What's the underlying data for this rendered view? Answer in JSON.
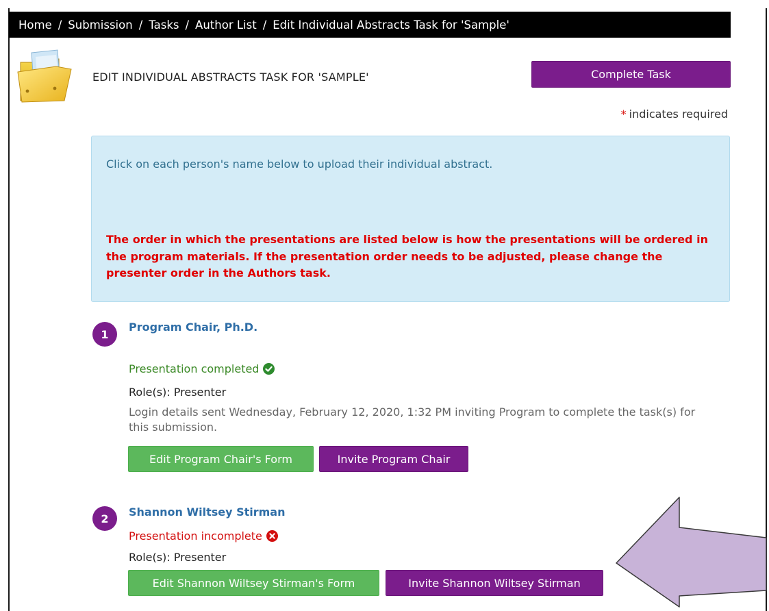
{
  "breadcrumb": [
    "Home",
    "Submission",
    "Tasks",
    "Author List",
    "Edit Individual Abstracts Task for 'Sample'"
  ],
  "breadcrumb_separator": "/",
  "page": {
    "title": "EDIT INDIVIDUAL ABSTRACTS TASK FOR 'SAMPLE'",
    "complete_button": "Complete Task",
    "required_star": "*",
    "required_text": "indicates required"
  },
  "info": {
    "instruction": "Click on each person's name below to upload their individual abstract.",
    "warning": "The order in which the presentations are listed below is how the presentations will be ordered in the program materials. If the presentation order needs to be adjusted, please change the presenter order in the Authors task."
  },
  "presenters": [
    {
      "number": "1",
      "name": "Program Chair, Ph.D.",
      "status": "Presentation completed",
      "role": "Role(s): Presenter",
      "login": "Login details sent Wednesday, February 12, 2020, 1:32 PM inviting Program to complete the task(s) for this submission.",
      "edit_button": "Edit Program Chair's Form",
      "invite_button": "Invite Program Chair"
    },
    {
      "number": "2",
      "name": "Shannon Wiltsey Stirman",
      "status": "Presentation incomplete",
      "role": "Role(s): Presenter",
      "edit_button": "Edit Shannon Wiltsey Stirman's Form",
      "invite_button": "Invite Shannon Wiltsey Stirman"
    }
  ],
  "colors": {
    "accent_purple": "#7b1d8c",
    "success_green": "#5cb85c",
    "link_blue": "#2f6ea7",
    "error_red": "#d30f0f",
    "info_bg": "#d4ecf7",
    "arrow_fill": "#c8b3d8"
  },
  "icons": [
    "folder-icon",
    "check-circle-icon",
    "x-circle-icon",
    "left-arrow-annotation"
  ]
}
